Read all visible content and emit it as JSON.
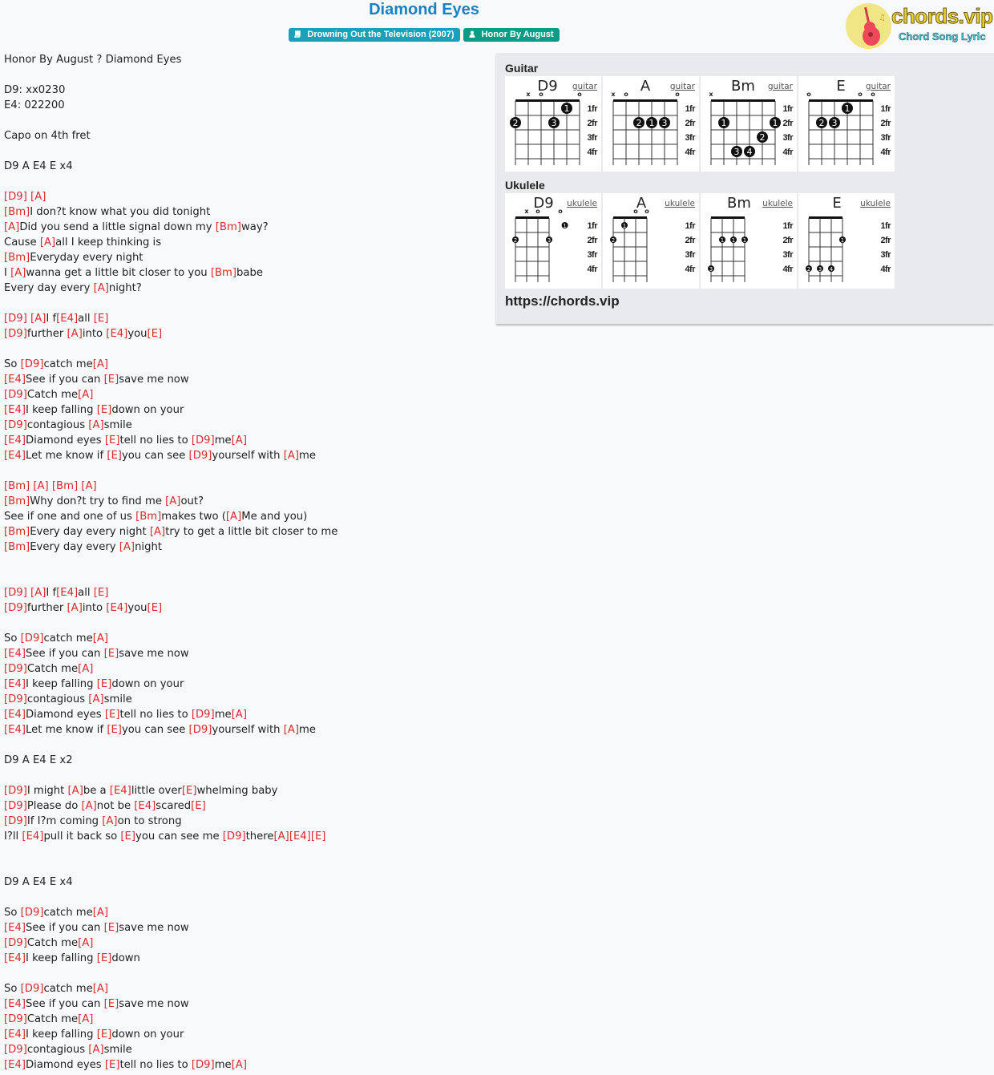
{
  "header": {
    "title": "Diamond Eyes",
    "album_badge": "Drowning Out the Television (2007)",
    "album_icon": "book-icon",
    "artist_badge": "Honor By August",
    "artist_icon": "user-icon",
    "logo_brand": "chords.vip",
    "logo_sub": "Chord Song Lyric",
    "colors": {
      "title": "#1a80c2",
      "album_badge": "#1aa0b8",
      "artist_badge": "#0c9c85",
      "chord": "#d92b2b"
    }
  },
  "lyrics": [
    "Honor By August ? Diamond Eyes",
    "",
    "D9: xx0230",
    "E4: 022200",
    "",
    "Capo on 4th fret",
    "",
    "D9 A E4 E x4",
    "",
    "[D9] [A]",
    "[Bm]I don?t know what you did tonight",
    "[A]Did you send a little signal down my [Bm]way?",
    "Cause [A]all I keep thinking is",
    "[Bm]Everyday every night",
    "I [A]wanna get a little bit closer to you [Bm]babe",
    "Every day every [A]night?",
    "",
    "[D9] [A]I f[E4]all [E]",
    "[D9]further [A]into [E4]you[E]",
    "",
    "So [D9]catch me[A]",
    "[E4]See if you can [E]save me now",
    "[D9]Catch me[A]",
    "[E4]I keep falling [E]down on your",
    "[D9]contagious [A]smile",
    "[E4]Diamond eyes [E]tell no lies to [D9]me[A]",
    "[E4]Let me know if [E]you can see [D9]yourself with [A]me",
    "",
    "[Bm] [A] [Bm] [A]",
    "[Bm]Why don?t try to find me [A]out?",
    "See if one and one of us [Bm]makes two ([A]Me and you)",
    "[Bm]Every day every night [A]try to get a little bit closer to me",
    "[Bm]Every day every [A]night",
    "",
    "",
    "[D9] [A]I f[E4]all [E]",
    "[D9]further [A]into [E4]you[E]",
    "",
    "So [D9]catch me[A]",
    "[E4]See if you can [E]save me now",
    "[D9]Catch me[A]",
    "[E4]I keep falling [E]down on your",
    "[D9]contagious [A]smile",
    "[E4]Diamond eyes [E]tell no lies to [D9]me[A]",
    "[E4]Let me know if [E]you can see [D9]yourself with [A]me",
    "",
    "D9 A E4 E x2",
    "",
    "[D9]I might [A]be a [E4]little over[E]whelming baby",
    "[D9]Please do [A]not be [E4]scared[E]",
    "[D9]If I?m coming [A]on to strong",
    "I?ll [E4]pull it back so [E]you can see me [D9]there[A][E4][E]",
    "",
    "",
    "D9 A E4 E x4",
    "",
    "So [D9]catch me[A]",
    "[E4]See if you can [E]save me now",
    "[D9]Catch me[A]",
    "[E4]I keep falling [E]down",
    "",
    "So [D9]catch me[A]",
    "[E4]See if you can [E]save me now",
    "[D9]Catch me[A]",
    "[E4]I keep falling [E]down on your",
    "[D9]contagious [A]smile",
    "[E4]Diamond eyes [E]tell no lies to [D9]me[A]"
  ],
  "chord_panel": {
    "guitar_label": "Guitar",
    "ukulele_label": "Ukulele",
    "fret_labels": [
      "1fr",
      "2fr",
      "3fr",
      "4fr"
    ],
    "url": "https://chords.vip",
    "guitar": [
      {
        "name": "D9",
        "link": "guitar",
        "markers": [
          "",
          "x",
          "o",
          "",
          "",
          "o"
        ],
        "dots": [
          {
            "string": 5,
            "fret": 1,
            "finger": "1"
          },
          {
            "string": 1,
            "fret": 2,
            "finger": "2"
          },
          {
            "string": 4,
            "fret": 2,
            "finger": "3"
          }
        ]
      },
      {
        "name": "A",
        "link": "guitar",
        "markers": [
          "x",
          "o",
          "",
          "",
          "",
          "o"
        ],
        "dots": [
          {
            "string": 3,
            "fret": 2,
            "finger": "2"
          },
          {
            "string": 4,
            "fret": 2,
            "finger": "1"
          },
          {
            "string": 5,
            "fret": 2,
            "finger": "3"
          }
        ]
      },
      {
        "name": "Bm",
        "link": "guitar",
        "markers": [
          "x",
          "",
          "",
          "",
          "",
          ""
        ],
        "dots": [
          {
            "string": 2,
            "fret": 2,
            "finger": "1"
          },
          {
            "string": 6,
            "fret": 2,
            "finger": "1"
          },
          {
            "string": 5,
            "fret": 3,
            "finger": "2"
          },
          {
            "string": 3,
            "fret": 4,
            "finger": "3"
          },
          {
            "string": 4,
            "fret": 4,
            "finger": "4"
          }
        ]
      },
      {
        "name": "E",
        "link": "guitar",
        "markers": [
          "o",
          "",
          "",
          "",
          "o",
          "o"
        ],
        "dots": [
          {
            "string": 4,
            "fret": 1,
            "finger": "1"
          },
          {
            "string": 2,
            "fret": 2,
            "finger": "2"
          },
          {
            "string": 3,
            "fret": 2,
            "finger": "3"
          }
        ]
      }
    ],
    "ukulele": [
      {
        "name": "D9",
        "link": "ukulele",
        "markers": [
          "",
          "x",
          "o",
          "",
          "o"
        ],
        "dots": [
          {
            "string": 5.4,
            "fret": 1,
            "finger": "1"
          },
          {
            "string": 1,
            "fret": 2,
            "finger": "2"
          },
          {
            "string": 4,
            "fret": 2,
            "finger": "3"
          }
        ]
      },
      {
        "name": "A",
        "link": "ukulele",
        "markers": [
          "",
          "",
          "o",
          "o"
        ],
        "dots": [
          {
            "string": 2,
            "fret": 1,
            "finger": "1"
          },
          {
            "string": 1,
            "fret": 2,
            "finger": "2"
          }
        ]
      },
      {
        "name": "Bm",
        "link": "ukulele",
        "markers": [
          "",
          "",
          "",
          ""
        ],
        "dots": [
          {
            "string": 2,
            "fret": 2,
            "finger": "1"
          },
          {
            "string": 3,
            "fret": 2,
            "finger": "1"
          },
          {
            "string": 4,
            "fret": 2,
            "finger": "1"
          },
          {
            "string": 1,
            "fret": 4,
            "finger": "3"
          }
        ]
      },
      {
        "name": "E",
        "link": "ukulele",
        "markers": [
          "",
          "",
          "",
          ""
        ],
        "dots": [
          {
            "string": 4,
            "fret": 2,
            "finger": "1"
          },
          {
            "string": 1,
            "fret": 4,
            "finger": "2"
          },
          {
            "string": 2,
            "fret": 4,
            "finger": "3"
          },
          {
            "string": 3,
            "fret": 4,
            "finger": "4"
          }
        ]
      }
    ]
  }
}
